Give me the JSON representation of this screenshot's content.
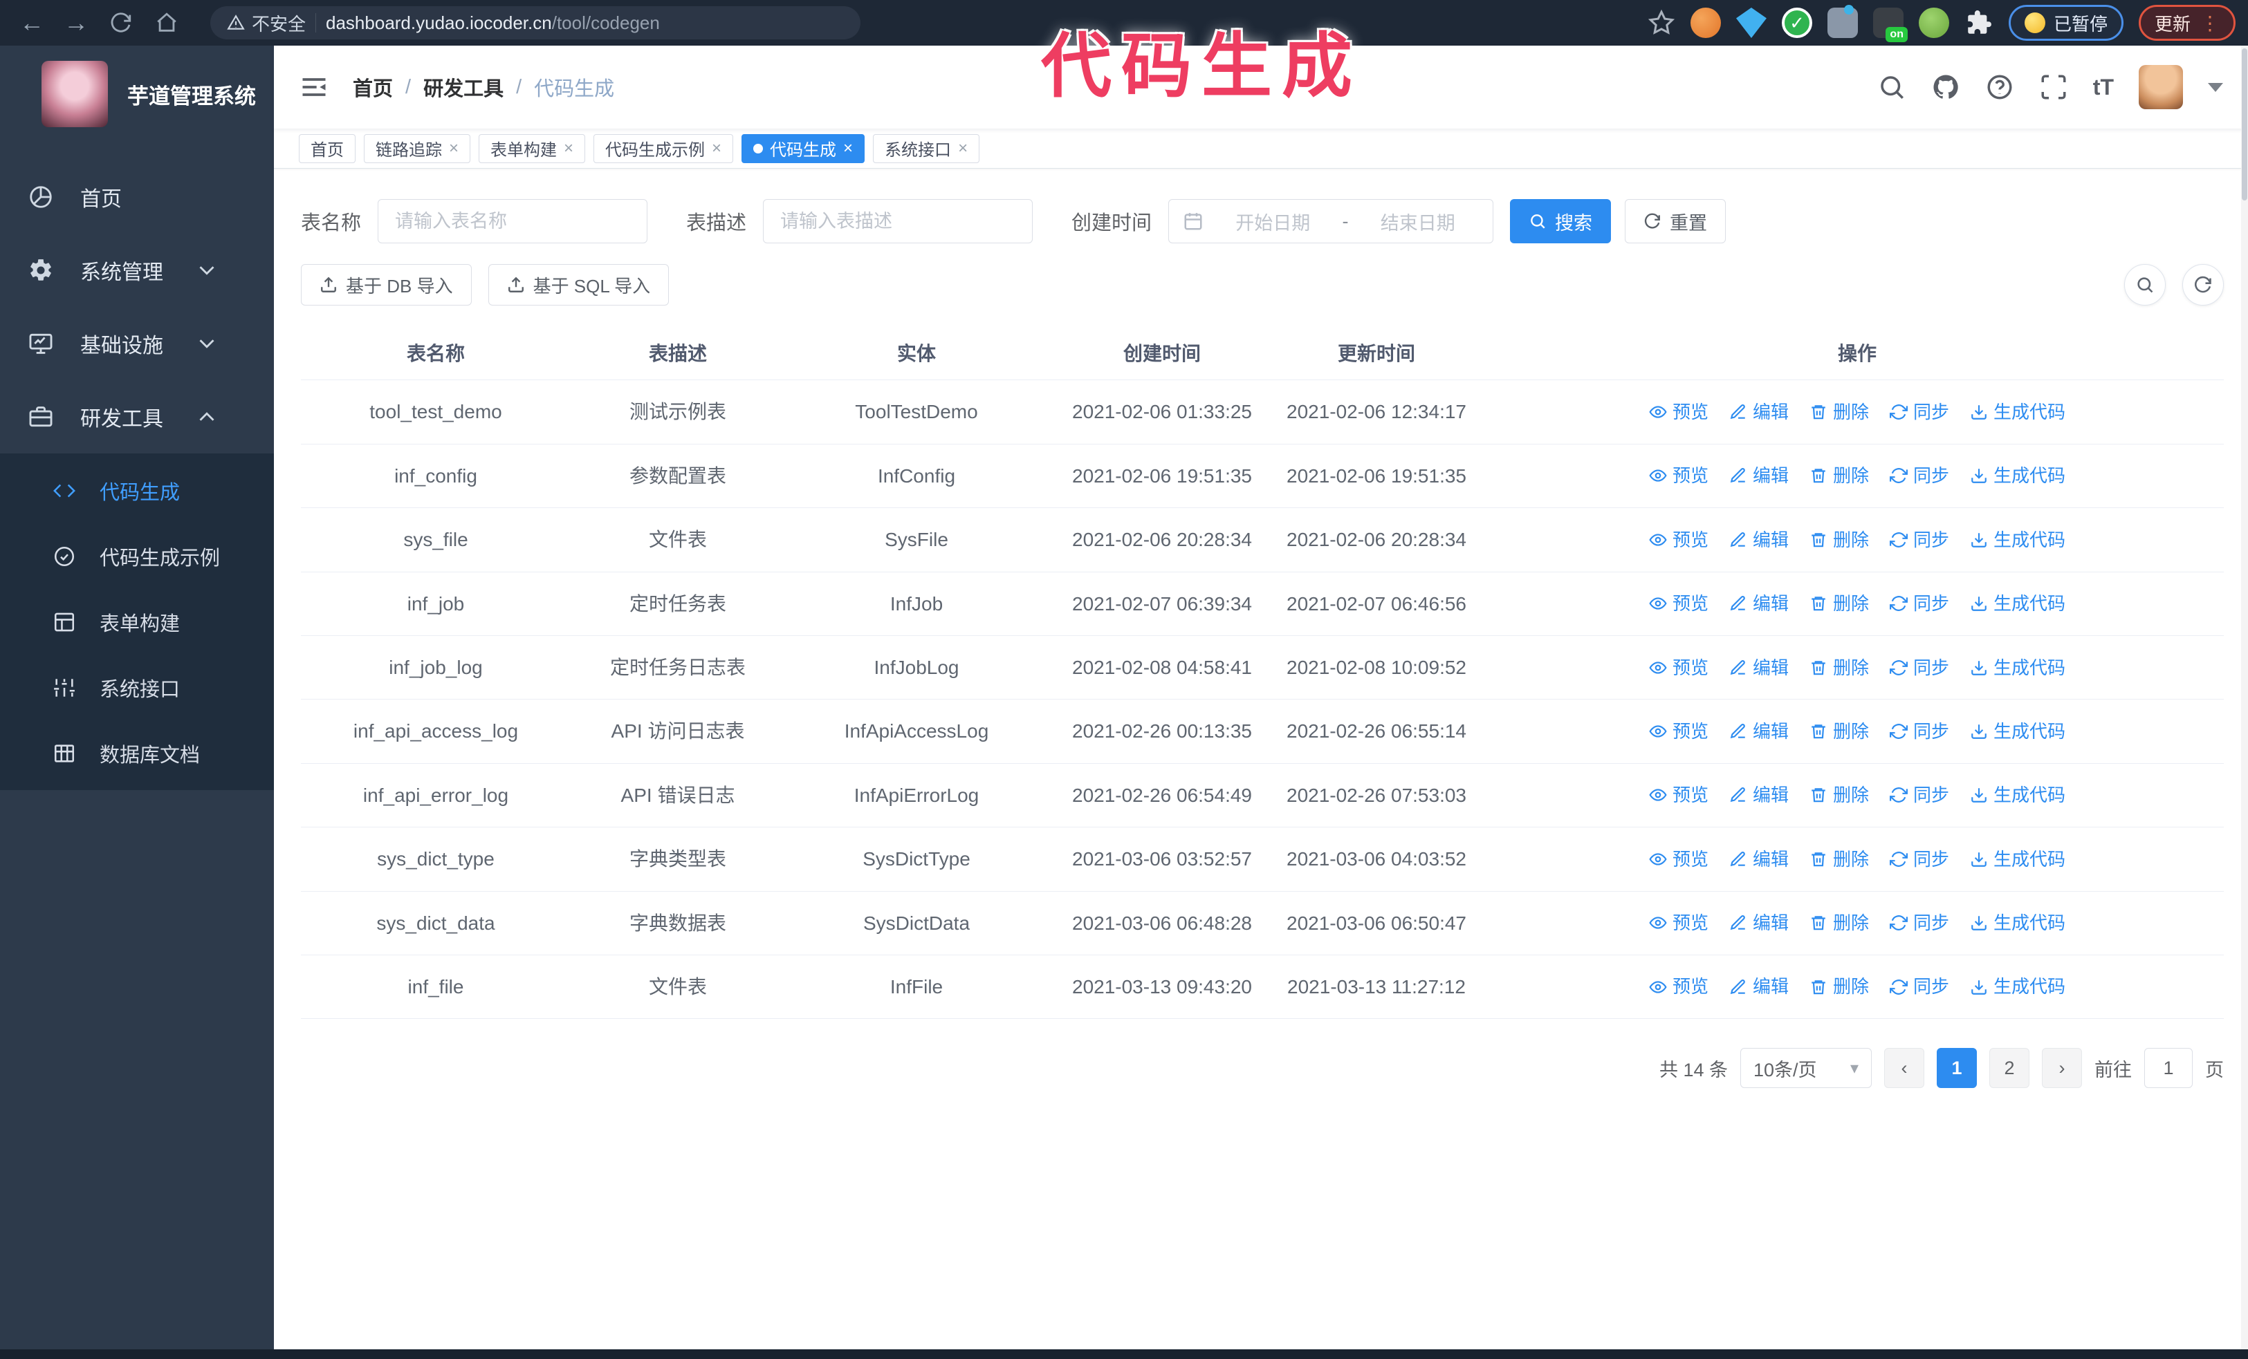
{
  "annotation": {
    "text": "代码生成",
    "color": "#ee3d61"
  },
  "colors": {
    "accent": "#2d8cf0",
    "sidebar_bg": "#2d3a4b",
    "submenu_bg": "#1f2d3d"
  },
  "browser": {
    "security_label": "不安全",
    "url_host": "dashboard.yudao.iocoder.cn",
    "url_path": "/tool/codegen",
    "ext_on_text": "on",
    "extension_badge": "已暂停",
    "update_button": "更新"
  },
  "sidebar": {
    "app_title": "芋道管理系统",
    "items": [
      {
        "label": "首页",
        "icon": "dashboard-icon"
      },
      {
        "label": "系统管理",
        "icon": "gear-icon",
        "state": "collapsed"
      },
      {
        "label": "基础设施",
        "icon": "infra-icon",
        "state": "collapsed"
      },
      {
        "label": "研发工具",
        "icon": "tools-icon",
        "state": "expanded"
      }
    ],
    "submenu": [
      {
        "label": "代码生成",
        "icon": "code-icon",
        "active": true
      },
      {
        "label": "代码生成示例",
        "icon": "example-icon",
        "active": false
      },
      {
        "label": "表单构建",
        "icon": "form-icon",
        "active": false
      },
      {
        "label": "系统接口",
        "icon": "api-icon",
        "active": false
      },
      {
        "label": "数据库文档",
        "icon": "dbdoc-icon",
        "active": false
      }
    ]
  },
  "navbar": {
    "breadcrumb": [
      "首页",
      "研发工具",
      "代码生成"
    ],
    "separator": "/"
  },
  "tabs": [
    {
      "label": "首页",
      "closable": false,
      "active": false
    },
    {
      "label": "链路追踪",
      "closable": true,
      "active": false
    },
    {
      "label": "表单构建",
      "closable": true,
      "active": false
    },
    {
      "label": "代码生成示例",
      "closable": true,
      "active": false
    },
    {
      "label": "代码生成",
      "closable": true,
      "active": true
    },
    {
      "label": "系统接口",
      "closable": true,
      "active": false
    }
  ],
  "search_form": {
    "table_name_label": "表名称",
    "table_name_placeholder": "请输入表名称",
    "table_desc_label": "表描述",
    "table_desc_placeholder": "请输入表描述",
    "create_time_label": "创建时间",
    "date_start_placeholder": "开始日期",
    "date_separator": "-",
    "date_end_placeholder": "结束日期",
    "search_button": "搜索",
    "reset_button": "重置"
  },
  "toolbar": {
    "import_db_button": "基于 DB 导入",
    "import_sql_button": "基于 SQL 导入"
  },
  "table": {
    "columns": [
      "表名称",
      "表描述",
      "实体",
      "创建时间",
      "更新时间",
      "操作"
    ],
    "actions": [
      {
        "label": "预览",
        "icon": "eye-icon",
        "key": "preview"
      },
      {
        "label": "编辑",
        "icon": "edit-icon",
        "key": "edit"
      },
      {
        "label": "删除",
        "icon": "delete-icon",
        "key": "delete"
      },
      {
        "label": "同步",
        "icon": "sync-icon",
        "key": "sync"
      },
      {
        "label": "生成代码",
        "icon": "download-icon",
        "key": "generate"
      }
    ],
    "rows": [
      {
        "name": "tool_test_demo",
        "desc": "测试示例表",
        "entity": "ToolTestDemo",
        "created": "2021-02-06 01:33:25",
        "updated": "2021-02-06 12:34:17"
      },
      {
        "name": "inf_config",
        "desc": "参数配置表",
        "entity": "InfConfig",
        "created": "2021-02-06 19:51:35",
        "updated": "2021-02-06 19:51:35"
      },
      {
        "name": "sys_file",
        "desc": "文件表",
        "entity": "SysFile",
        "created": "2021-02-06 20:28:34",
        "updated": "2021-02-06 20:28:34"
      },
      {
        "name": "inf_job",
        "desc": "定时任务表",
        "entity": "InfJob",
        "created": "2021-02-07 06:39:34",
        "updated": "2021-02-07 06:46:56"
      },
      {
        "name": "inf_job_log",
        "desc": "定时任务日志表",
        "entity": "InfJobLog",
        "created": "2021-02-08 04:58:41",
        "updated": "2021-02-08 10:09:52"
      },
      {
        "name": "inf_api_access_log",
        "desc": "API 访问日志表",
        "entity": "InfApiAccessLog",
        "created": "2021-02-26 00:13:35",
        "updated": "2021-02-26 06:55:14"
      },
      {
        "name": "inf_api_error_log",
        "desc": "API 错误日志",
        "entity": "InfApiErrorLog",
        "created": "2021-02-26 06:54:49",
        "updated": "2021-02-26 07:53:03"
      },
      {
        "name": "sys_dict_type",
        "desc": "字典类型表",
        "entity": "SysDictType",
        "created": "2021-03-06 03:52:57",
        "updated": "2021-03-06 04:03:52"
      },
      {
        "name": "sys_dict_data",
        "desc": "字典数据表",
        "entity": "SysDictData",
        "created": "2021-03-06 06:48:28",
        "updated": "2021-03-06 06:50:47"
      },
      {
        "name": "inf_file",
        "desc": "文件表",
        "entity": "InfFile",
        "created": "2021-03-13 09:43:20",
        "updated": "2021-03-13 11:27:12"
      }
    ]
  },
  "pagination": {
    "total_text": "共 14 条",
    "page_size": "10条/页",
    "prev": "‹",
    "next": "›",
    "pages": [
      "1",
      "2"
    ],
    "active_page": "1",
    "goto_label": "前往",
    "goto_value": "1",
    "goto_suffix": "页"
  }
}
